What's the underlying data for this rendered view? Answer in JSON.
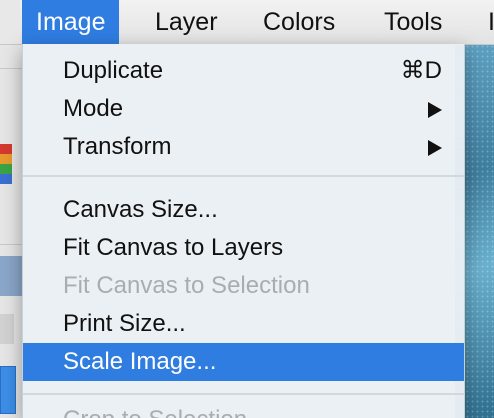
{
  "menubar": {
    "items": [
      {
        "label": "Image",
        "active": true
      },
      {
        "label": "Layer"
      },
      {
        "label": "Colors"
      },
      {
        "label": "Tools"
      },
      {
        "label": "I"
      }
    ]
  },
  "dropdown": {
    "items": [
      {
        "label": "Duplicate",
        "shortcut": "⌘D",
        "enabled": true
      },
      {
        "label": "Mode",
        "submenu": true,
        "enabled": true
      },
      {
        "label": "Transform",
        "submenu": true,
        "enabled": true
      },
      {
        "label": "Canvas Size...",
        "enabled": true
      },
      {
        "label": "Fit Canvas to Layers",
        "enabled": true
      },
      {
        "label": "Fit Canvas to Selection",
        "enabled": false
      },
      {
        "label": "Print Size...",
        "enabled": true
      },
      {
        "label": "Scale Image...",
        "enabled": true,
        "highlighted": true
      },
      {
        "label": "Crop to Selection",
        "enabled": false
      }
    ]
  },
  "colors": {
    "accent": "#2f7de1",
    "disabled_text": "#a9adb1",
    "menu_bg": "#eaf0f4"
  }
}
